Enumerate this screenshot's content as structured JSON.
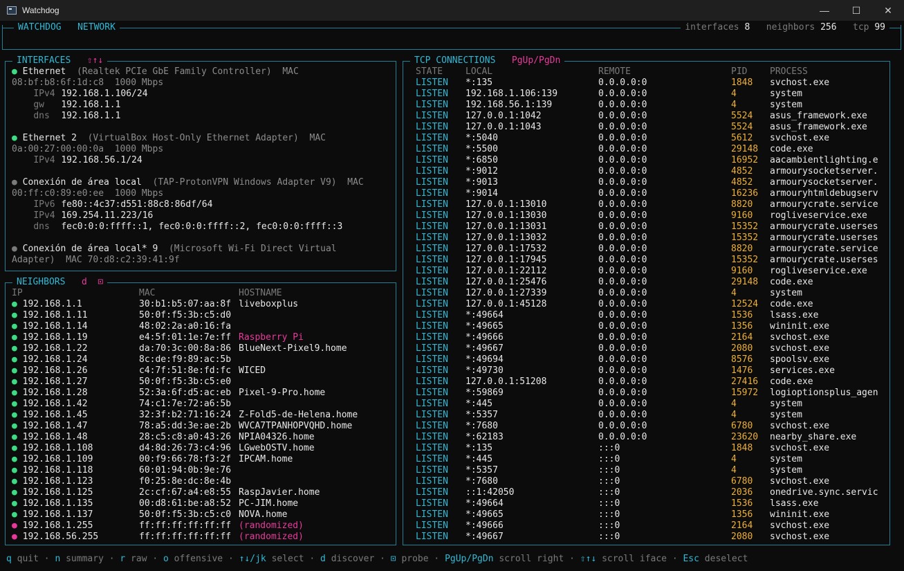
{
  "window": {
    "title": "Watchdog",
    "minimize": "—",
    "maximize": "☐",
    "close": "✕"
  },
  "header": {
    "app": "WATCHDOG",
    "section": "NETWORK",
    "stats": [
      {
        "label": "interfaces",
        "value": "8"
      },
      {
        "label": "neighbors",
        "value": "256"
      },
      {
        "label": "tcp",
        "value": "99"
      }
    ]
  },
  "interfaces": {
    "title": "INTERFACES",
    "hint": "⇧↑↓",
    "items": [
      {
        "status": "up",
        "name": "Ethernet",
        "description": "(Realtek PCIe GbE Family Controller)",
        "mac_label": "MAC",
        "mac_wrap": "08:bf:b8:6f:1d:c8",
        "speed": "1000 Mbps",
        "rows": [
          {
            "label": "IPv4",
            "value": "192.168.1.106/24"
          },
          {
            "label": "gw",
            "value": "192.168.1.1"
          },
          {
            "label": "dns",
            "value": "192.168.1.1"
          }
        ]
      },
      {
        "status": "up",
        "name": "Ethernet 2",
        "description": "(VirtualBox Host-Only Ethernet Adapter)",
        "mac_label": "MAC",
        "mac_wrap": "0a:00:27:00:00:0a",
        "speed": "1000 Mbps",
        "rows": [
          {
            "label": "IPv4",
            "value": "192.168.56.1/24"
          }
        ]
      },
      {
        "status": "down",
        "name": "Conexión de área local",
        "description": "(TAP-ProtonVPN Windows Adapter V9)",
        "mac_label": "MAC",
        "mac_wrap": "00:ff:c0:89:e0:ee",
        "speed": "1000 Mbps",
        "rows": [
          {
            "label": "IPv6",
            "value": "fe80::4c37:d551:88c8:86df/64"
          },
          {
            "label": "IPv4",
            "value": "169.254.11.223/16"
          },
          {
            "label": "dns",
            "value": "fec0:0:0:ffff::1, fec0:0:0:ffff::2, fec0:0:0:ffff::3"
          }
        ]
      },
      {
        "status": "down",
        "name": "Conexión de área local* 9",
        "description": "(Microsoft Wi-Fi Direct Virtual",
        "mac_label": "MAC",
        "mac_wrap": "Adapter)",
        "mac_inline": "MAC 70:d8:c2:39:41:9f",
        "speed": "",
        "rows": []
      }
    ]
  },
  "neighbors": {
    "title": "NEIGHBORS",
    "key_d": "d",
    "key_probe": "⊡",
    "headers": {
      "ip": "IP",
      "mac": "MAC",
      "hostname": "HOSTNAME"
    },
    "rows": [
      {
        "status": "up",
        "ip": "192.168.1.1",
        "mac": "30:b1:b5:07:aa:8f",
        "hostname": "liveboxplus",
        "highlight": false
      },
      {
        "status": "up",
        "ip": "192.168.1.11",
        "mac": "50:0f:f5:3b:c5:d0",
        "hostname": "",
        "highlight": false
      },
      {
        "status": "up",
        "ip": "192.168.1.14",
        "mac": "48:02:2a:a0:16:fa",
        "hostname": "",
        "highlight": false
      },
      {
        "status": "up",
        "ip": "192.168.1.19",
        "mac": "e4:5f:01:1e:7e:ff",
        "hostname": "Raspberry Pi",
        "highlight": true
      },
      {
        "status": "up",
        "ip": "192.168.1.22",
        "mac": "da:70:3c:00:8a:86",
        "hostname": "BlueNext-Pixel9.home",
        "highlight": false
      },
      {
        "status": "up",
        "ip": "192.168.1.24",
        "mac": "8c:de:f9:89:ac:5b",
        "hostname": "",
        "highlight": false
      },
      {
        "status": "up",
        "ip": "192.168.1.26",
        "mac": "c4:7f:51:8e:fd:fc",
        "hostname": "WICED",
        "highlight": false
      },
      {
        "status": "up",
        "ip": "192.168.1.27",
        "mac": "50:0f:f5:3b:c5:e0",
        "hostname": "",
        "highlight": false
      },
      {
        "status": "up",
        "ip": "192.168.1.28",
        "mac": "52:3a:6f:d5:ac:eb",
        "hostname": "Pixel-9-Pro.home",
        "highlight": false
      },
      {
        "status": "up",
        "ip": "192.168.1.42",
        "mac": "74:c1:7e:72:a6:5b",
        "hostname": "",
        "highlight": false
      },
      {
        "status": "up",
        "ip": "192.168.1.45",
        "mac": "32:3f:b2:71:16:24",
        "hostname": "Z-Fold5-de-Helena.home",
        "highlight": false
      },
      {
        "status": "up",
        "ip": "192.168.1.47",
        "mac": "78:a5:dd:3e:ae:2b",
        "hostname": "WVCA7TPANHOPVQHD.home",
        "highlight": false
      },
      {
        "status": "up",
        "ip": "192.168.1.48",
        "mac": "28:c5:c8:a0:43:26",
        "hostname": "NPIA04326.home",
        "highlight": false
      },
      {
        "status": "up",
        "ip": "192.168.1.108",
        "mac": "d4:8d:26:73:c4:96",
        "hostname": "LGwebOSTV.home",
        "highlight": false
      },
      {
        "status": "up",
        "ip": "192.168.1.109",
        "mac": "00:f9:66:78:f3:2f",
        "hostname": "IPCAM.home",
        "highlight": false
      },
      {
        "status": "up",
        "ip": "192.168.1.118",
        "mac": "60:01:94:0b:9e:76",
        "hostname": "",
        "highlight": false
      },
      {
        "status": "up",
        "ip": "192.168.1.123",
        "mac": "f0:25:8e:dc:8e:4b",
        "hostname": "",
        "highlight": false
      },
      {
        "status": "up",
        "ip": "192.168.1.125",
        "mac": "2c:cf:67:a4:e8:55",
        "hostname": "RaspJavier.home",
        "highlight": false
      },
      {
        "status": "up",
        "ip": "192.168.1.135",
        "mac": "00:d8:61:be:a8:52",
        "hostname": "PC-JIM.home",
        "highlight": false
      },
      {
        "status": "up",
        "ip": "192.168.1.137",
        "mac": "50:0f:f5:3b:c5:c0",
        "hostname": "NOVA.home",
        "highlight": false
      },
      {
        "status": "random",
        "ip": "192.168.1.255",
        "mac": "ff:ff:ff:ff:ff:ff",
        "hostname": "(randomized)",
        "highlight": true
      },
      {
        "status": "random",
        "ip": "192.168.56.255",
        "mac": "ff:ff:ff:ff:ff:ff",
        "hostname": "(randomized)",
        "highlight": true
      }
    ]
  },
  "tcp": {
    "title": "TCP CONNECTIONS",
    "hint": "PgUp/PgDn",
    "headers": {
      "state": "STATE",
      "local": "LOCAL",
      "remote": "REMOTE",
      "pid": "PID",
      "process": "PROCESS"
    },
    "rows": [
      [
        "LISTEN",
        "*:135",
        "0.0.0.0:0",
        "1848",
        "svchost.exe"
      ],
      [
        "LISTEN",
        "192.168.1.106:139",
        "0.0.0.0:0",
        "4",
        "system"
      ],
      [
        "LISTEN",
        "192.168.56.1:139",
        "0.0.0.0:0",
        "4",
        "system"
      ],
      [
        "LISTEN",
        "127.0.0.1:1042",
        "0.0.0.0:0",
        "5524",
        "asus_framework.exe"
      ],
      [
        "LISTEN",
        "127.0.0.1:1043",
        "0.0.0.0:0",
        "5524",
        "asus_framework.exe"
      ],
      [
        "LISTEN",
        "*:5040",
        "0.0.0.0:0",
        "5612",
        "svchost.exe"
      ],
      [
        "LISTEN",
        "*:5500",
        "0.0.0.0:0",
        "29148",
        "code.exe"
      ],
      [
        "LISTEN",
        "*:6850",
        "0.0.0.0:0",
        "16952",
        "aacambientlighting.e"
      ],
      [
        "LISTEN",
        "*:9012",
        "0.0.0.0:0",
        "4852",
        "armourysocketserver."
      ],
      [
        "LISTEN",
        "*:9013",
        "0.0.0.0:0",
        "4852",
        "armourysocketserver."
      ],
      [
        "LISTEN",
        "*:9014",
        "0.0.0.0:0",
        "16236",
        "armouryhtmldebugserv"
      ],
      [
        "LISTEN",
        "127.0.0.1:13010",
        "0.0.0.0:0",
        "8820",
        "armourycrate.service"
      ],
      [
        "LISTEN",
        "127.0.0.1:13030",
        "0.0.0.0:0",
        "9160",
        "rogliveservice.exe"
      ],
      [
        "LISTEN",
        "127.0.0.1:13031",
        "0.0.0.0:0",
        "15352",
        "armourycrate.userses"
      ],
      [
        "LISTEN",
        "127.0.0.1:13032",
        "0.0.0.0:0",
        "15352",
        "armourycrate.userses"
      ],
      [
        "LISTEN",
        "127.0.0.1:17532",
        "0.0.0.0:0",
        "8820",
        "armourycrate.service"
      ],
      [
        "LISTEN",
        "127.0.0.1:17945",
        "0.0.0.0:0",
        "15352",
        "armourycrate.userses"
      ],
      [
        "LISTEN",
        "127.0.0.1:22112",
        "0.0.0.0:0",
        "9160",
        "rogliveservice.exe"
      ],
      [
        "LISTEN",
        "127.0.0.1:25476",
        "0.0.0.0:0",
        "29148",
        "code.exe"
      ],
      [
        "LISTEN",
        "127.0.0.1:27339",
        "0.0.0.0:0",
        "4",
        "system"
      ],
      [
        "LISTEN",
        "127.0.0.1:45128",
        "0.0.0.0:0",
        "12524",
        "code.exe"
      ],
      [
        "LISTEN",
        "*:49664",
        "0.0.0.0:0",
        "1536",
        "lsass.exe"
      ],
      [
        "LISTEN",
        "*:49665",
        "0.0.0.0:0",
        "1356",
        "wininit.exe"
      ],
      [
        "LISTEN",
        "*:49666",
        "0.0.0.0:0",
        "2164",
        "svchost.exe"
      ],
      [
        "LISTEN",
        "*:49667",
        "0.0.0.0:0",
        "2080",
        "svchost.exe"
      ],
      [
        "LISTEN",
        "*:49694",
        "0.0.0.0:0",
        "8576",
        "spoolsv.exe"
      ],
      [
        "LISTEN",
        "*:49730",
        "0.0.0.0:0",
        "1476",
        "services.exe"
      ],
      [
        "LISTEN",
        "127.0.0.1:51208",
        "0.0.0.0:0",
        "27416",
        "code.exe"
      ],
      [
        "LISTEN",
        "*:59869",
        "0.0.0.0:0",
        "15972",
        "logioptionsplus_agen"
      ],
      [
        "LISTEN",
        "*:445",
        "0.0.0.0:0",
        "4",
        "system"
      ],
      [
        "LISTEN",
        "*:5357",
        "0.0.0.0:0",
        "4",
        "system"
      ],
      [
        "LISTEN",
        "*:7680",
        "0.0.0.0:0",
        "6780",
        "svchost.exe"
      ],
      [
        "LISTEN",
        "*:62183",
        "0.0.0.0:0",
        "23620",
        "nearby_share.exe"
      ],
      [
        "LISTEN",
        "*:135",
        ":::0",
        "1848",
        "svchost.exe"
      ],
      [
        "LISTEN",
        "*:445",
        ":::0",
        "4",
        "system"
      ],
      [
        "LISTEN",
        "*:5357",
        ":::0",
        "4",
        "system"
      ],
      [
        "LISTEN",
        "*:7680",
        ":::0",
        "6780",
        "svchost.exe"
      ],
      [
        "LISTEN",
        "::1:42050",
        ":::0",
        "2036",
        "onedrive.sync.servic"
      ],
      [
        "LISTEN",
        "*:49664",
        ":::0",
        "1536",
        "lsass.exe"
      ],
      [
        "LISTEN",
        "*:49665",
        ":::0",
        "1356",
        "wininit.exe"
      ],
      [
        "LISTEN",
        "*:49666",
        ":::0",
        "2164",
        "svchost.exe"
      ],
      [
        "LISTEN",
        "*:49667",
        ":::0",
        "2080",
        "svchost.exe"
      ]
    ]
  },
  "footer": [
    {
      "key": "q",
      "label": "quit"
    },
    {
      "key": "n",
      "label": "summary"
    },
    {
      "key": "r",
      "label": "raw"
    },
    {
      "key": "o",
      "label": "offensive"
    },
    {
      "key": "↑↓/jk",
      "label": "select"
    },
    {
      "key": "d",
      "label": "discover"
    },
    {
      "key": "⊡",
      "label": "probe"
    },
    {
      "key": "PgUp/PgDn",
      "label": "scroll right"
    },
    {
      "key": "⇧↑↓",
      "label": "scroll iface"
    },
    {
      "key": "Esc",
      "label": "deselect"
    }
  ],
  "footer_separator": "·"
}
